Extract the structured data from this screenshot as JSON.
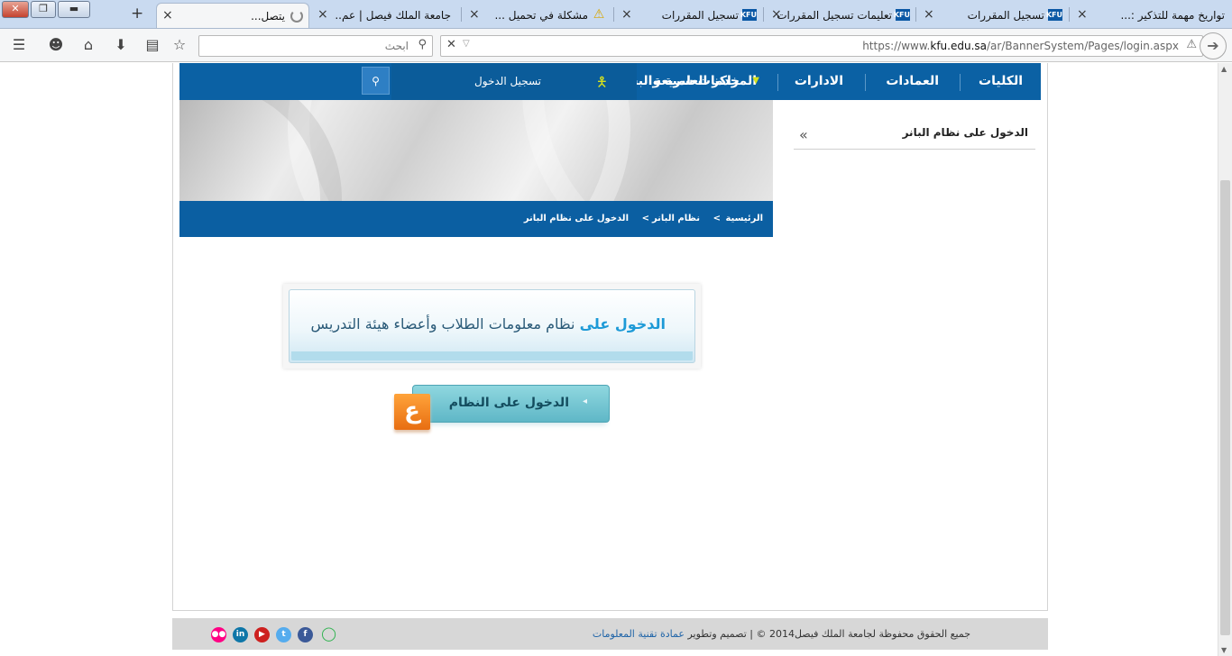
{
  "browser": {
    "tabs": [
      {
        "label": "تواريخ مهمة للتذكير :...",
        "icon": "none"
      },
      {
        "label": "تسجيل المقررات",
        "icon": "kfu"
      },
      {
        "label": "تعليمات تسجيل المقررات",
        "icon": "kfu"
      },
      {
        "label": "تسجيل المقررات",
        "icon": "kfu"
      },
      {
        "label": "مشكلة في تحميل ...",
        "icon": "warning"
      },
      {
        "label": "جامعة الملك فيصل | عم...",
        "icon": "none"
      },
      {
        "label": "يتصل...",
        "icon": "loading",
        "active": true
      }
    ],
    "kfu_icon_text": "KFU",
    "close_glyph": "×",
    "new_tab": "+",
    "window_controls": {
      "close": "✕",
      "maximize": "❐",
      "minimize": "▬"
    },
    "search_placeholder": "ابحث",
    "url_prefix": "https://www.",
    "url_host": "kfu.edu.sa",
    "url_path": "/ar/BannerSystem/Pages/login.aspx",
    "toolbar_icons": [
      "menu-icon",
      "emoji-icon",
      "home-icon",
      "download-icon",
      "reading-list-icon",
      "bookmark-star-icon"
    ]
  },
  "site": {
    "menu": {
      "colleges": "الكليات",
      "deanships": "العمادات",
      "administrations": "الادارات",
      "research_centers": "المراكز العلمية والبحثية",
      "quick_services": "خدمات سريعة",
      "login": "تسجيل الدخول"
    },
    "breadcrumbs": [
      "الرئيسية",
      "نظام البانر",
      "الدخول على نظام البانر"
    ],
    "breadcrumb_sep": ">",
    "side_title": "الدخول على نظام البانر",
    "panel": {
      "highlight": "الدخول على",
      "text": "نظام معلومات الطلاب وأعضاء هيئة التدريس"
    },
    "enter_button": "الدخول على النظام",
    "enter_badge": "ع",
    "footer": {
      "text": "جميع الحقوق محفوظة لجامعة الملك فيصل2014 © | تصميم وتطوير",
      "link": "عمادة تقنية المعلومات"
    },
    "social": [
      {
        "name": "chat",
        "glyph": "💬",
        "color": "#2bb24c"
      },
      {
        "name": "facebook",
        "glyph": "f",
        "color": "#3b5998"
      },
      {
        "name": "twitter",
        "glyph": "t",
        "color": "#55acee"
      },
      {
        "name": "youtube",
        "glyph": "▶",
        "color": "#cd201f"
      },
      {
        "name": "linkedin",
        "glyph": "in",
        "color": "#0e76a8"
      },
      {
        "name": "flickr",
        "glyph": "●●",
        "color": "#ff0084"
      }
    ]
  }
}
